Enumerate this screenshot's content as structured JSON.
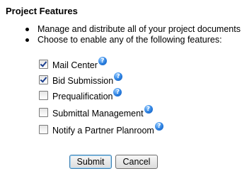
{
  "title": "Project Features",
  "bullets": [
    "Manage and distribute all of your project documents",
    "Choose to enable any of the following features:"
  ],
  "features": [
    {
      "label": "Mail Center",
      "checked": true,
      "help_icon": "?"
    },
    {
      "label": "Bid Submission",
      "checked": true,
      "help_icon": "?"
    },
    {
      "label": "Prequalification",
      "checked": false,
      "help_icon": "?"
    },
    {
      "label": "Submittal Management",
      "checked": false,
      "help_icon": "?"
    },
    {
      "label": "Notify a Partner Planroom",
      "checked": false,
      "help_icon": "?"
    }
  ],
  "buttons": {
    "submit": "Submit",
    "cancel": "Cancel"
  },
  "colors": {
    "help_icon": "#2a7fe0",
    "checkmark": "#1c3f8f"
  }
}
